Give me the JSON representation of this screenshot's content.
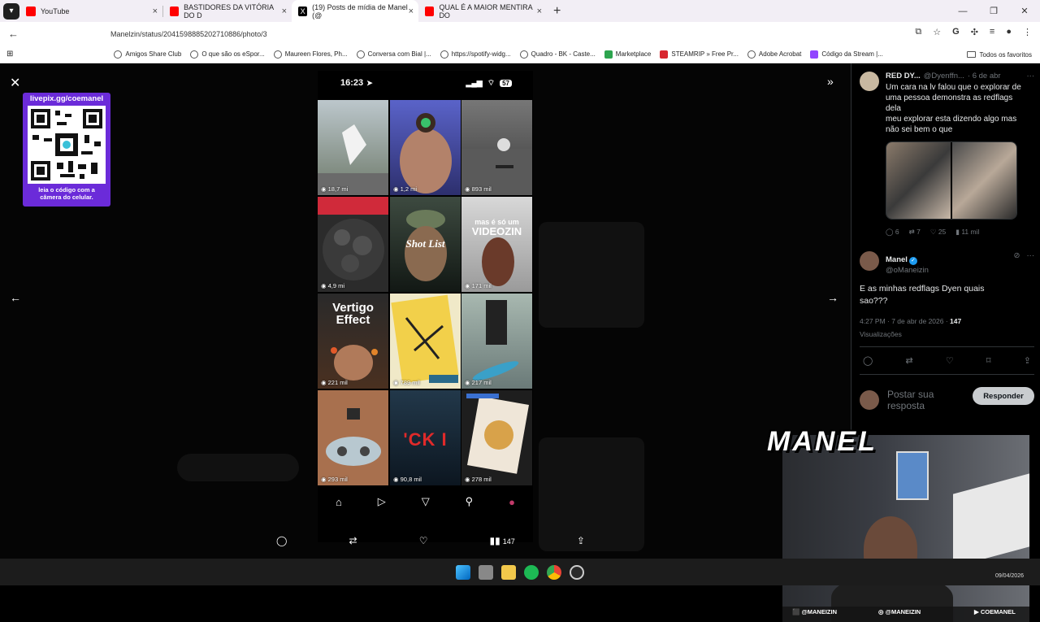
{
  "browser": {
    "tabs": [
      {
        "title": "YouTube",
        "color": "#ff0000"
      },
      {
        "title": "BASTIDORES DA VITÓRIA DO D",
        "color": "#ff0000"
      },
      {
        "title": "(19) Posts de mídia de Manel (@",
        "color": "#000000",
        "active": true
      },
      {
        "title": "QUAL É A MAIOR MENTIRA DO",
        "color": "#ff0000"
      }
    ],
    "url": "Manelzin/status/2041598885202710886/photo/3",
    "bookmarks": [
      "Amigos Share Club",
      "O que são os eSpor...",
      "Maureen Flores, Ph...",
      "Conversa com Bial |...",
      "https://spotify-widg...",
      "Quadro - BK - Caste...",
      "Marketplace",
      "STEAMRIP » Free Pr...",
      "Adobe Acrobat",
      "Código da Stream |..."
    ],
    "bookmarks_all": "Todos os favoritos"
  },
  "overlay_qr": {
    "title": "livepix.gg/coemanel",
    "caption_line1": "leia o código com a",
    "caption_line2": "câmera do celular."
  },
  "phone": {
    "time": "16:23",
    "battery": "57",
    "tiles": [
      {
        "views": "18,7 mi",
        "bg": "#6e7a6a"
      },
      {
        "views": "1,2 mi",
        "bg": "#3b3f8c"
      },
      {
        "views": "893 mil",
        "bg": "#4a4a4a"
      },
      {
        "views": "4,9 mi",
        "bg": "#2b2b2b",
        "top": "#d02a3a"
      },
      {
        "views": "",
        "bg": "#1e2a22",
        "text": "Shot List"
      },
      {
        "views": "171 mil",
        "bg": "#c9c9c9",
        "text": "mas é só um VIDEOZIN"
      },
      {
        "views": "221 mil",
        "bg": "#3a2a22",
        "text": "Vertigo Effect"
      },
      {
        "views": "789 mil",
        "bg": "#e8d9a0"
      },
      {
        "views": "217 mil",
        "bg": "#6e8a8a"
      },
      {
        "views": "293 mil",
        "bg": "#8a5a44"
      },
      {
        "views": "90,8 mil",
        "bg": "#1a2a3a",
        "text": "CK"
      },
      {
        "views": "278 mil",
        "bg": "#1e1e1e"
      }
    ]
  },
  "bottom_bar": {
    "views": "147"
  },
  "thread": {
    "tweet1": {
      "name": "RED DY...",
      "handle": "@Dyenffn...",
      "date": "· 6 de abr",
      "text_lines": [
        "Um cara na lv falou que o explorar de",
        "uma pessoa demonstra as redflags",
        "dela",
        "meu explorar esta dizendo algo mas",
        "não sei bem o que"
      ],
      "replies": "6",
      "reposts": "7",
      "likes": "25",
      "views": "11 mil"
    },
    "tweet2": {
      "name": "Manel",
      "handle": "@oManeizin",
      "text_lines": [
        "E as minhas redflags Dyen quais",
        "sao???"
      ],
      "meta": "4:27 PM · 7 de abr de 2026 · ",
      "views": "147",
      "views_label": "Visualizações"
    },
    "reply_placeholder_1": "Postar sua",
    "reply_placeholder_2": "resposta",
    "reply_button": "Responder"
  },
  "webcam": {
    "logo": "MANEL",
    "tags": [
      "@MANEIZIN",
      "@MANEIZIN",
      "COEMANEL"
    ],
    "date": "09/04/2026"
  }
}
